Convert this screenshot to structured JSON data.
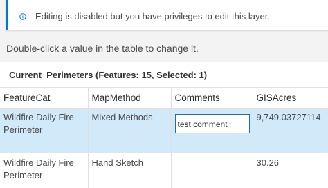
{
  "notice": {
    "icon": "info-circle-icon",
    "text": "Editing is disabled but you have privileges to edit this layer.",
    "accent_color": "#007ac2"
  },
  "instruction": "Double-click a value in the table to change it.",
  "table": {
    "title": "Current_Perimeters (Features: 15, Selected: 1)",
    "columns": [
      "FeatureCat",
      "MapMethod",
      "Comments",
      "GISAcres"
    ],
    "rows": [
      {
        "selected": true,
        "featurecat": "Wildfire Daily Fire Perimeter",
        "mapmethod": "Mixed Methods",
        "comments": "test comment",
        "gisacres": "9,749.03727114"
      },
      {
        "selected": false,
        "featurecat": "Wildfire Daily Fire Perimeter",
        "mapmethod": "Hand Sketch",
        "comments": "",
        "gisacres": "30.26"
      }
    ],
    "selected_row_color": "#d2e9f9"
  }
}
